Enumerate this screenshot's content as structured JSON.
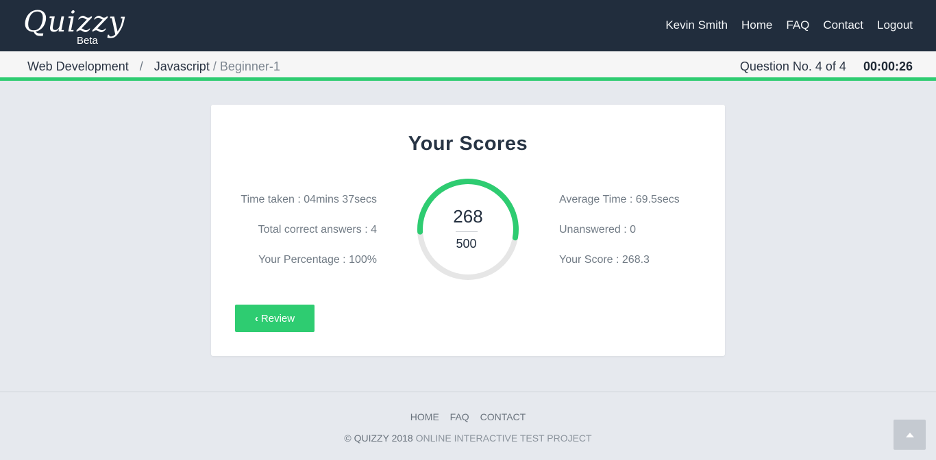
{
  "brand": {
    "name": "Quizzy",
    "tag": "Beta"
  },
  "nav": {
    "user": "Kevin Smith",
    "items": [
      "Home",
      "FAQ",
      "Contact",
      "Logout"
    ]
  },
  "breadcrumb": {
    "items": [
      "Web Development",
      "Javascript"
    ],
    "separator": "/",
    "current": "/ Beginner-1"
  },
  "quiz": {
    "question_status": "Question No. 4 of 4",
    "timer": "00:00:26"
  },
  "scores": {
    "title": "Your Scores",
    "left": [
      "Time taken : 04mins 37secs",
      "Total correct answers : 4",
      "Your Percentage : 100%"
    ],
    "right": [
      "Average Time : 69.5secs",
      "Unanswered : 0",
      "Your Score : 268.3"
    ],
    "gauge": {
      "score": "268",
      "total": "500",
      "fraction": 0.536
    },
    "review_label": "Review"
  },
  "footer": {
    "links": [
      "HOME",
      "FAQ",
      "CONTACT"
    ],
    "copyright": "© QUIZZY 2018",
    "tagline": "ONLINE INTERACTIVE TEST PROJECT"
  },
  "colors": {
    "header_bg": "#212d3d",
    "accent": "#2ecc71",
    "page_bg": "#e6e9ee",
    "gauge_track": "#e6e6e6"
  },
  "icons": {
    "review": "chevron-left-icon",
    "scroll_top": "arrow-up-icon"
  }
}
